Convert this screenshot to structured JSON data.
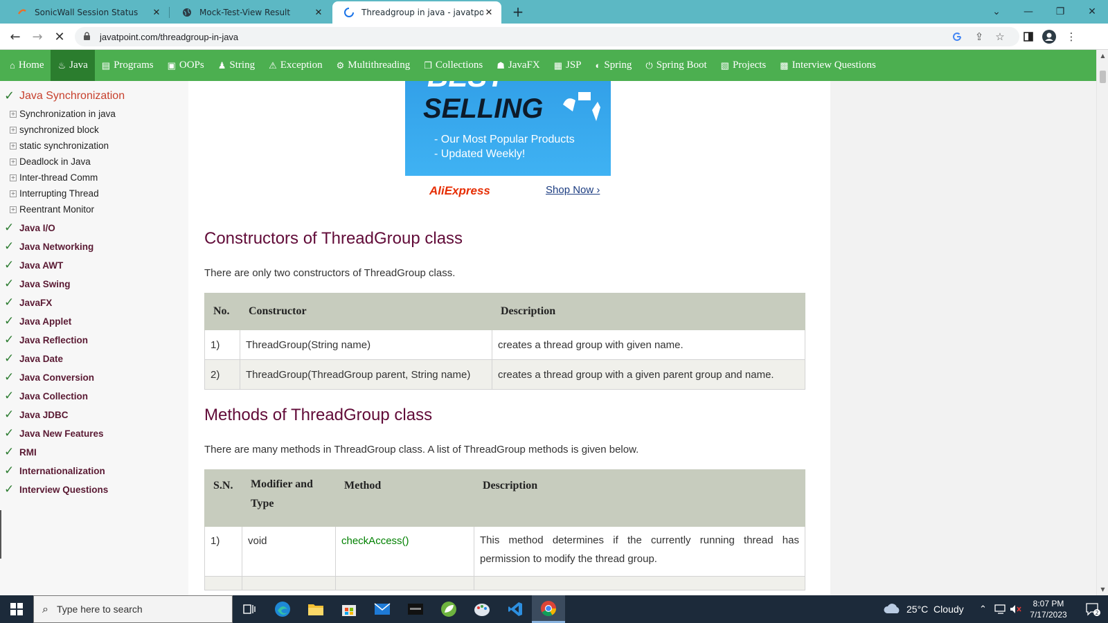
{
  "browser": {
    "tabs": [
      {
        "title": "SonicWall Session Status",
        "icon": "sonicwall-icon",
        "active": false
      },
      {
        "title": "Mock-Test-View Result",
        "icon": "globe-icon",
        "active": false
      },
      {
        "title": "Threadgroup in java - javatpoint",
        "icon": "loading-spinner-icon",
        "active": true
      }
    ],
    "url": "javatpoint.com/threadgroup-in-java"
  },
  "site_nav": [
    {
      "label": "Home",
      "icon": "home-icon"
    },
    {
      "label": "Java",
      "icon": "java-cup-icon"
    },
    {
      "label": "Programs",
      "icon": "programs-icon"
    },
    {
      "label": "OOPs",
      "icon": "oops-icon"
    },
    {
      "label": "String",
      "icon": "string-icon"
    },
    {
      "label": "Exception",
      "icon": "warning-icon"
    },
    {
      "label": "Multithreading",
      "icon": "multithreading-icon"
    },
    {
      "label": "Collections",
      "icon": "collections-icon"
    },
    {
      "label": "JavaFX",
      "icon": "javafx-icon"
    },
    {
      "label": "JSP",
      "icon": "jsp-icon"
    },
    {
      "label": "Spring",
      "icon": "spring-icon"
    },
    {
      "label": "Spring Boot",
      "icon": "spring-boot-icon"
    },
    {
      "label": "Projects",
      "icon": "projects-icon"
    },
    {
      "label": "Interview Questions",
      "icon": "interview-icon"
    }
  ],
  "sidebar": {
    "section_title": "Java Synchronization",
    "sub_items": [
      "Synchronization in java",
      "synchronized block",
      "static synchronization",
      "Deadlock in Java",
      "Inter-thread Comm",
      "Interrupting Thread",
      "Reentrant Monitor"
    ],
    "topics": [
      "Java I/O",
      "Java Networking",
      "Java AWT",
      "Java Swing",
      "JavaFX",
      "Java Applet",
      "Java Reflection",
      "Java Date",
      "Java Conversion",
      "Java Collection",
      "Java JDBC",
      "Java New Features",
      "RMI",
      "Internationalization",
      "Interview Questions"
    ]
  },
  "ad": {
    "headline_top": "BEST",
    "headline": "SELLING",
    "line1": "- Our Most Popular Products",
    "line2": "- Updated Weekly!",
    "brand": "AliExpress",
    "cta": "Shop Now ›"
  },
  "content": {
    "constructors_heading": "Constructors of ThreadGroup class",
    "constructors_intro": "There are only two constructors of ThreadGroup class.",
    "constructors_table": {
      "headers": [
        "No.",
        "Constructor",
        "Description"
      ],
      "rows": [
        [
          "1)",
          "ThreadGroup(String name)",
          "creates a thread group with given name."
        ],
        [
          "2)",
          "ThreadGroup(ThreadGroup parent, String name)",
          "creates a thread group with a given parent group and name."
        ]
      ]
    },
    "methods_heading": "Methods of ThreadGroup class",
    "methods_intro": "There are many methods in ThreadGroup class. A list of ThreadGroup methods is given below.",
    "methods_table": {
      "headers": [
        "S.N.",
        "Modifier and Type",
        "Method",
        "Description"
      ],
      "rows": [
        [
          "1)",
          "void",
          "checkAccess()",
          "This method determines if the currently running thread has permission to modify the thread group."
        ]
      ]
    }
  },
  "taskbar": {
    "search_placeholder": "Type here to search",
    "weather": "25°C  Cloudy",
    "time": "8:07 PM",
    "date": "7/17/2023",
    "notification_count": "2",
    "apps": [
      "task-view-icon",
      "edge-icon",
      "file-explorer-icon",
      "store-icon",
      "mail-icon",
      "terminal-app-icon",
      "spring-tool-icon",
      "paint-icon",
      "vscode-icon",
      "chrome-icon"
    ]
  },
  "colors": {
    "tabbar": "#5cb8c4",
    "site_nav": "#4caf50",
    "site_nav_active": "#2b7d2e",
    "heading": "#610b38",
    "table_header": "#c7ccbe",
    "method_link": "#008000"
  }
}
